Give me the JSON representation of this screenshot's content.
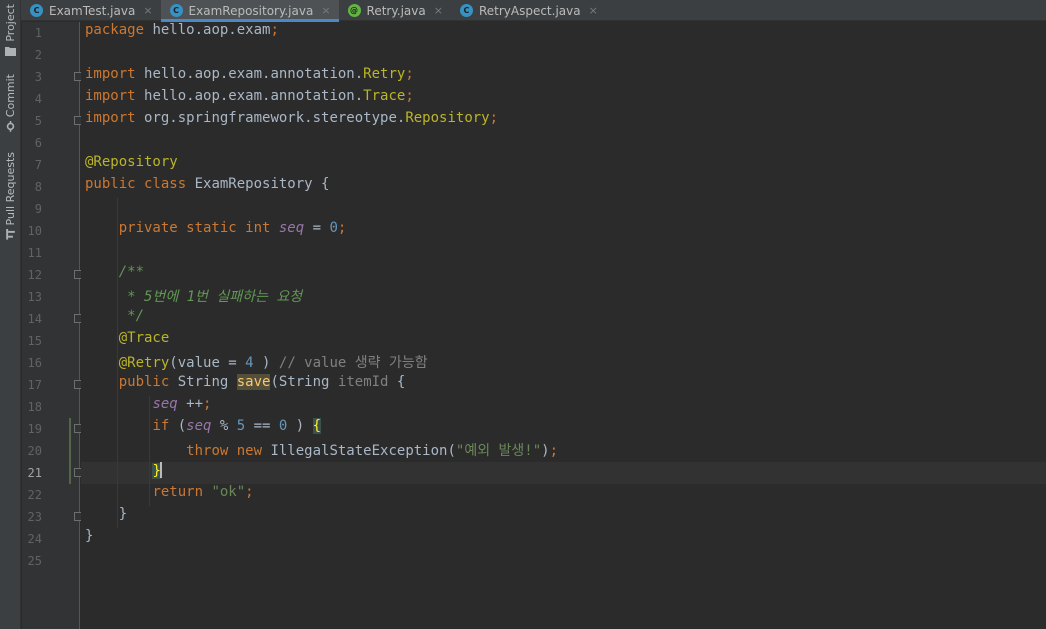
{
  "sidebar": {
    "tools": [
      {
        "label": "Project",
        "icon": "folder-icon"
      },
      {
        "label": "Commit",
        "icon": "commit-icon"
      },
      {
        "label": "Pull Requests",
        "icon": "pull-request-icon"
      }
    ]
  },
  "tabs": [
    {
      "label": "ExamTest.java",
      "icon_letter": "C",
      "icon_color": "#3592c4",
      "active": false
    },
    {
      "label": "ExamRepository.java",
      "icon_letter": "C",
      "icon_color": "#3592c4",
      "active": true
    },
    {
      "label": "Retry.java",
      "icon_letter": "@",
      "icon_color": "#62b543",
      "active": false
    },
    {
      "label": "RetryAspect.java",
      "icon_letter": "C",
      "icon_color": "#3592c4",
      "active": false
    }
  ],
  "close_glyph": "×",
  "editor": {
    "current_line": 21,
    "lines": [
      {
        "n": "1",
        "tokens": [
          [
            "kw",
            "package"
          ],
          [
            "",
            "hello.aop.exam"
          ],
          [
            "kw",
            ";"
          ]
        ]
      },
      {
        "n": "2",
        "tokens": []
      },
      {
        "n": "3",
        "tokens": [
          [
            "kw",
            "import"
          ],
          [
            "",
            "hello.aop.exam.annotation."
          ],
          [
            "ann",
            "Retry"
          ],
          [
            "kw",
            ";"
          ]
        ]
      },
      {
        "n": "4",
        "tokens": [
          [
            "kw",
            "import"
          ],
          [
            "",
            "hello.aop.exam.annotation."
          ],
          [
            "ann",
            "Trace"
          ],
          [
            "kw",
            ";"
          ]
        ]
      },
      {
        "n": "5",
        "tokens": [
          [
            "kw",
            "import"
          ],
          [
            "",
            "org.springframework.stereotype."
          ],
          [
            "ann",
            "Repository"
          ],
          [
            "kw",
            ";"
          ]
        ]
      },
      {
        "n": "6",
        "tokens": []
      },
      {
        "n": "7",
        "tokens": [
          [
            "ann",
            "@Repository"
          ]
        ]
      },
      {
        "n": "8",
        "tokens": [
          [
            "kw",
            "public class"
          ],
          [
            "",
            "ExamRepository {"
          ]
        ]
      },
      {
        "n": "9",
        "tokens": []
      },
      {
        "n": "10",
        "tokens": [
          [
            "",
            "    "
          ],
          [
            "kw",
            "private static int"
          ],
          [
            "fld",
            "seq"
          ],
          [
            "",
            " = "
          ],
          [
            "num",
            "0"
          ],
          [
            "kw",
            ";"
          ]
        ]
      },
      {
        "n": "11",
        "tokens": []
      },
      {
        "n": "12",
        "tokens": [
          [
            "",
            "    "
          ],
          [
            "doc",
            "/**"
          ]
        ]
      },
      {
        "n": "13",
        "tokens": [
          [
            "",
            "     "
          ],
          [
            "doc",
            "* 5번에 1번 실패하는 요청"
          ]
        ]
      },
      {
        "n": "14",
        "tokens": [
          [
            "",
            "     "
          ],
          [
            "doc",
            "*/"
          ]
        ]
      },
      {
        "n": "15",
        "tokens": [
          [
            "",
            "    "
          ],
          [
            "ann",
            "@Trace"
          ]
        ]
      },
      {
        "n": "16",
        "tokens": [
          [
            "",
            "    "
          ],
          [
            "ann",
            "@Retry"
          ],
          [
            "",
            "(value = "
          ],
          [
            "num",
            "4"
          ],
          [
            "",
            ") "
          ],
          [
            "cm",
            "// value 생략 가능함"
          ]
        ]
      },
      {
        "n": "17",
        "tokens": [
          [
            "",
            "    "
          ],
          [
            "kw",
            "public"
          ],
          [
            "",
            "String "
          ],
          [
            "mdecl",
            "save"
          ],
          [
            "",
            "(String "
          ],
          [
            "cm",
            "itemId"
          ],
          [
            "",
            " {"
          ]
        ]
      },
      {
        "n": "18",
        "tokens": [
          [
            "",
            "        "
          ],
          [
            "fld",
            "seq"
          ],
          [
            "",
            " ++"
          ],
          [
            "kw",
            ";"
          ]
        ]
      },
      {
        "n": "19",
        "tokens": [
          [
            "",
            "        "
          ],
          [
            "kw",
            "if"
          ],
          [
            "",
            " ("
          ],
          [
            "fld",
            "seq"
          ],
          [
            "",
            " % "
          ],
          [
            "num",
            "5"
          ],
          [
            "",
            " == "
          ],
          [
            "num",
            "0"
          ],
          [
            "",
            ") "
          ],
          [
            "brace",
            "{"
          ]
        ]
      },
      {
        "n": "20",
        "tokens": [
          [
            "",
            "            "
          ],
          [
            "kw",
            "throw new"
          ],
          [
            "",
            "IllegalStateException("
          ],
          [
            "str",
            "\"예외 발생!\""
          ],
          [
            "",
            ")"
          ],
          [
            "kw",
            ";"
          ]
        ]
      },
      {
        "n": "21",
        "tokens": [
          [
            "",
            "        "
          ],
          [
            "brace",
            "}"
          ],
          [
            "caret",
            ""
          ]
        ]
      },
      {
        "n": "22",
        "tokens": [
          [
            "",
            "        "
          ],
          [
            "kw",
            "return"
          ],
          [
            "str",
            "\"ok\""
          ],
          [
            "kw",
            ";"
          ]
        ]
      },
      {
        "n": "23",
        "tokens": [
          [
            "",
            "    }"
          ]
        ]
      },
      {
        "n": "24",
        "tokens": [
          [
            "",
            "}"
          ]
        ]
      },
      {
        "n": "25",
        "tokens": []
      }
    ]
  }
}
